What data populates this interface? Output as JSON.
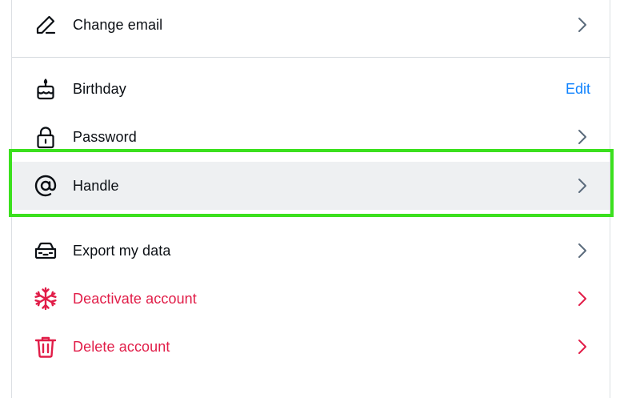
{
  "settings": {
    "items": [
      {
        "label": "Change email",
        "icon": "pencil-icon"
      },
      {
        "label": "Birthday",
        "icon": "cake-icon",
        "action": "Edit"
      },
      {
        "label": "Password",
        "icon": "lock-icon"
      },
      {
        "label": "Handle",
        "icon": "at-icon"
      },
      {
        "label": "Export my data",
        "icon": "car-icon"
      },
      {
        "label": "Deactivate account",
        "icon": "snowflake-icon"
      },
      {
        "label": "Delete account",
        "icon": "trash-icon"
      }
    ]
  },
  "colors": {
    "text": "#0b0f14",
    "danger": "#e11d48",
    "link": "#1083fe",
    "chevron": "#5b6b7c",
    "selected_bg": "#eef0f2",
    "highlight": "#3be01e"
  }
}
